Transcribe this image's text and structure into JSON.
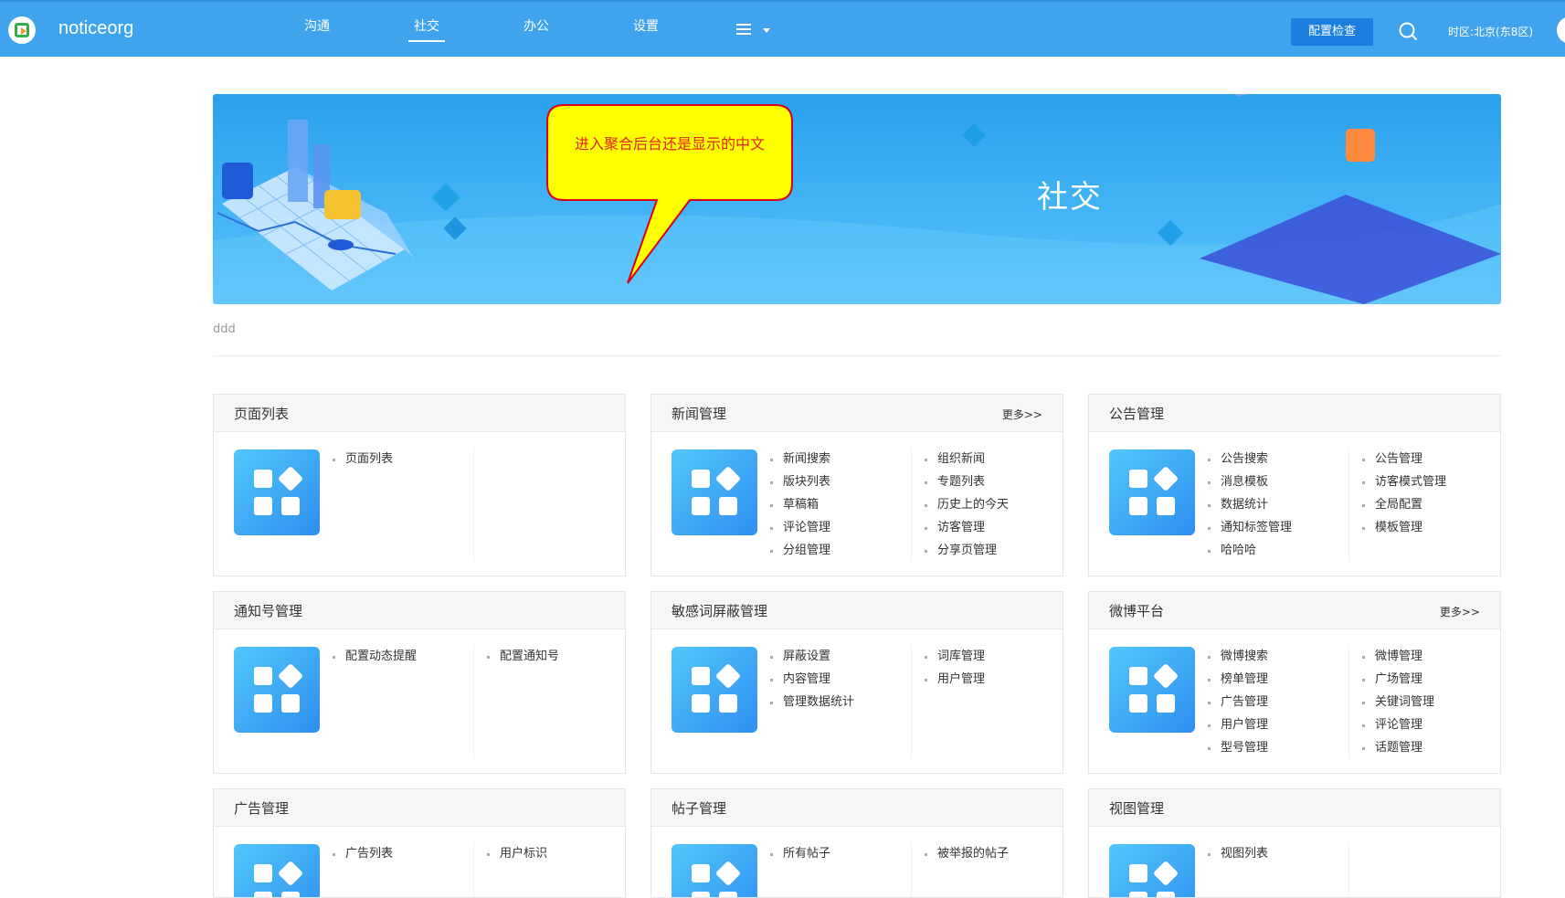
{
  "header": {
    "brand": "noticeorg",
    "nav": [
      {
        "label": "沟通",
        "active": false
      },
      {
        "label": "社交",
        "active": true
      },
      {
        "label": "办公",
        "active": false
      },
      {
        "label": "设置",
        "active": false
      }
    ],
    "config_button": "配置检查",
    "timezone": "时区:北京(东8区)"
  },
  "banner": {
    "title": "社交",
    "callout": "进入聚合后台还是显示的中文"
  },
  "description": "ddd",
  "cards": [
    {
      "title": "页面列表",
      "more": "",
      "col1": [
        "页面列表"
      ],
      "col2": []
    },
    {
      "title": "新闻管理",
      "more": "更多>>",
      "col1": [
        "新闻搜索",
        "版块列表",
        "草稿箱",
        "评论管理",
        "分组管理"
      ],
      "col2": [
        "组织新闻",
        "专题列表",
        "历史上的今天",
        "访客管理",
        "分享页管理"
      ]
    },
    {
      "title": "公告管理",
      "more": "",
      "col1": [
        "公告搜索",
        "消息模板",
        "数据统计",
        "通知标签管理",
        "哈哈哈"
      ],
      "col2": [
        "公告管理",
        "访客模式管理",
        "全局配置",
        "模板管理"
      ]
    },
    {
      "title": "通知号管理",
      "more": "",
      "col1": [
        "配置动态提醒"
      ],
      "col2": [
        "配置通知号"
      ]
    },
    {
      "title": "敏感词屏蔽管理",
      "more": "",
      "col1": [
        "屏蔽设置",
        "内容管理",
        "管理数据统计"
      ],
      "col2": [
        "词库管理",
        "用户管理"
      ]
    },
    {
      "title": "微博平台",
      "more": "更多>>",
      "col1": [
        "微博搜索",
        "榜单管理",
        "广告管理",
        "用户管理",
        "型号管理"
      ],
      "col2": [
        "微博管理",
        "广场管理",
        "关键词管理",
        "评论管理",
        "话题管理"
      ]
    },
    {
      "title": "广告管理",
      "more": "",
      "col1": [
        "广告列表"
      ],
      "col2": [
        "用户标识"
      ]
    },
    {
      "title": "帖子管理",
      "more": "",
      "col1": [
        "所有帖子"
      ],
      "col2": [
        "被举报的帖子"
      ]
    },
    {
      "title": "视图管理",
      "more": "",
      "col1": [
        "视图列表"
      ],
      "col2": []
    }
  ],
  "colors": {
    "header_bg": "#3fa3ee",
    "accent_button": "#1a7fe0",
    "callout_fill": "#ffff00",
    "callout_border": "#d9001b",
    "callout_text": "#e2231a"
  }
}
